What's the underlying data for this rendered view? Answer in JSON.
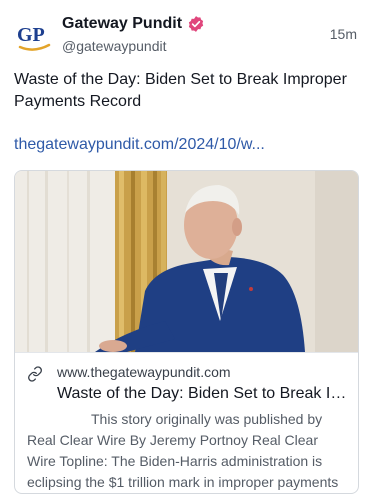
{
  "post": {
    "author": {
      "display_name": "Gateway Pundit",
      "handle": "@gatewaypundit",
      "avatar_text": "GP",
      "verified": true
    },
    "time": "15m",
    "text": "Waste of the Day: Biden Set to Break Improper Payments Record",
    "link_text": "thegatewaypundit.com/2024/10/w..."
  },
  "card": {
    "domain": "www.thegatewaypundit.com",
    "title": "Waste of the Day: Biden Set to Break Improper Payments Record",
    "description": "This story originally was published by Real Clear Wire By Jeremy Portnoy Real Clear Wire Topline: The Biden-Harris administration is eclipsing the $1 trillion mark in improper payments",
    "image_icon": "photo-of-man-in-suit"
  },
  "colors": {
    "link": "#2f5aa8",
    "verified_badge": "#e0467c",
    "avatar_blue": "#1d3f8f",
    "avatar_gold": "#e3a42a"
  }
}
